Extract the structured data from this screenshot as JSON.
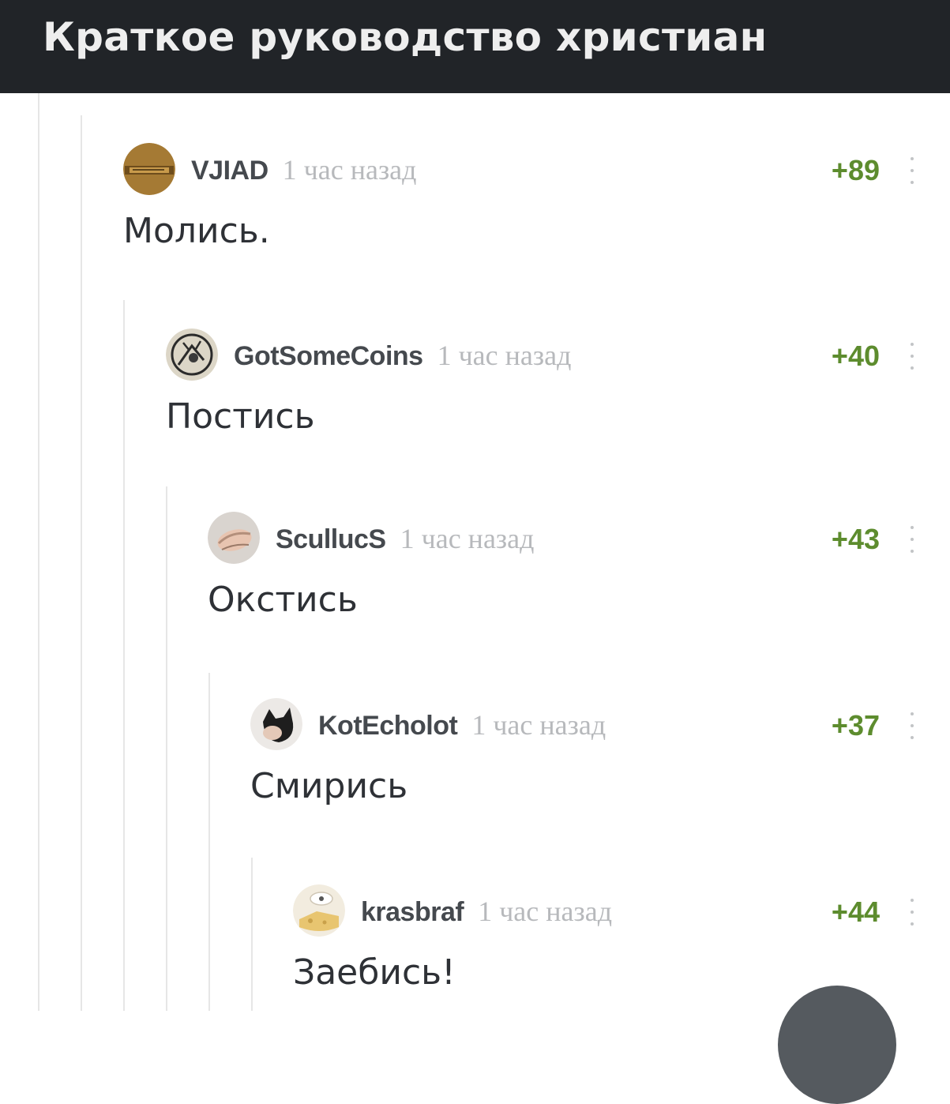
{
  "title": "Краткое руководство христиан",
  "colors": {
    "header_bg": "#212428",
    "rating_green": "#5d8c2e",
    "timestamp_gray": "#b7b9bc"
  },
  "comments": [
    {
      "author": "VJIAD",
      "time": "1 час назад",
      "rating": "+89",
      "text": "Молись.",
      "avatar": "avatar-icon"
    },
    {
      "author": "GotSomeCoins",
      "time": "1 час назад",
      "rating": "+40",
      "text": "Постись",
      "avatar": "avatar-icon"
    },
    {
      "author": "ScullucS",
      "time": "1 час назад",
      "rating": "+43",
      "text": "Окстись",
      "avatar": "avatar-icon"
    },
    {
      "author": "KotEcholot",
      "time": "1 час назад",
      "rating": "+37",
      "text": "Смирись",
      "avatar": "avatar-icon"
    },
    {
      "author": "krasbraf",
      "time": "1 час назад",
      "rating": "+44",
      "text": "Заебись!",
      "avatar": "avatar-icon"
    }
  ]
}
